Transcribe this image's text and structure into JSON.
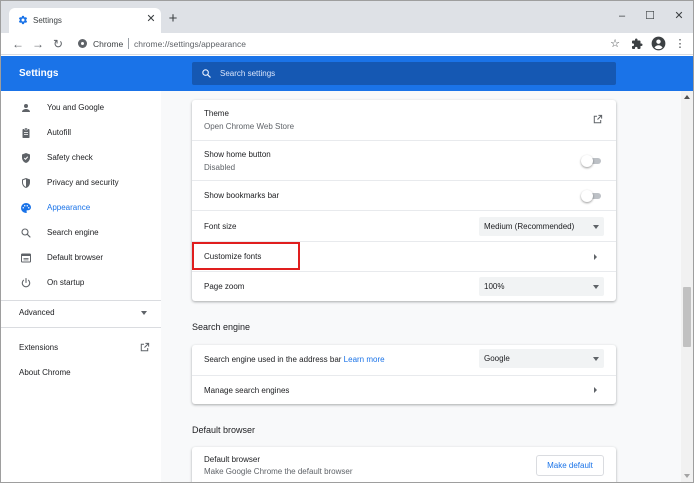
{
  "tab": {
    "title": "Settings",
    "close_glyph": "✕",
    "new_tab_glyph": "+"
  },
  "window_controls": {
    "minimize": "–",
    "maximize": "☐",
    "close": "✕"
  },
  "toolbar": {
    "back_glyph": "←",
    "forward_glyph": "→",
    "reload_glyph": "↻",
    "site_name": "Chrome",
    "url_path": "chrome://settings/appearance",
    "star_glyph": "☆",
    "menu_glyph": "⋮"
  },
  "header": {
    "title": "Settings",
    "search_placeholder": "Search settings",
    "accent_color": "#1a73e8"
  },
  "sidebar": {
    "items": [
      {
        "label": "You and Google",
        "icon": "person-icon"
      },
      {
        "label": "Autofill",
        "icon": "clipboard-icon"
      },
      {
        "label": "Safety check",
        "icon": "shield-check-icon"
      },
      {
        "label": "Privacy and security",
        "icon": "shield-icon"
      },
      {
        "label": "Appearance",
        "icon": "palette-icon",
        "active": true
      },
      {
        "label": "Search engine",
        "icon": "search-icon"
      },
      {
        "label": "Default browser",
        "icon": "browser-icon"
      },
      {
        "label": "On startup",
        "icon": "power-icon"
      }
    ],
    "advanced_label": "Advanced",
    "extensions_label": "Extensions",
    "about_label": "About Chrome"
  },
  "appearance": {
    "theme_label": "Theme",
    "theme_sub": "Open Chrome Web Store",
    "home_button_label": "Show home button",
    "home_button_sub": "Disabled",
    "bookmarks_bar_label": "Show bookmarks bar",
    "font_size_label": "Font size",
    "font_size_value": "Medium (Recommended)",
    "customize_fonts_label": "Customize fonts",
    "page_zoom_label": "Page zoom",
    "page_zoom_value": "100%"
  },
  "search_engine": {
    "section_title": "Search engine",
    "used_label": "Search engine used in the address bar",
    "learn_more": "Learn more",
    "engine_value": "Google",
    "manage_label": "Manage search engines"
  },
  "default_browser": {
    "section_title": "Default browser",
    "label": "Default browser",
    "sub": "Make Google Chrome the default browser",
    "button_label": "Make default"
  }
}
